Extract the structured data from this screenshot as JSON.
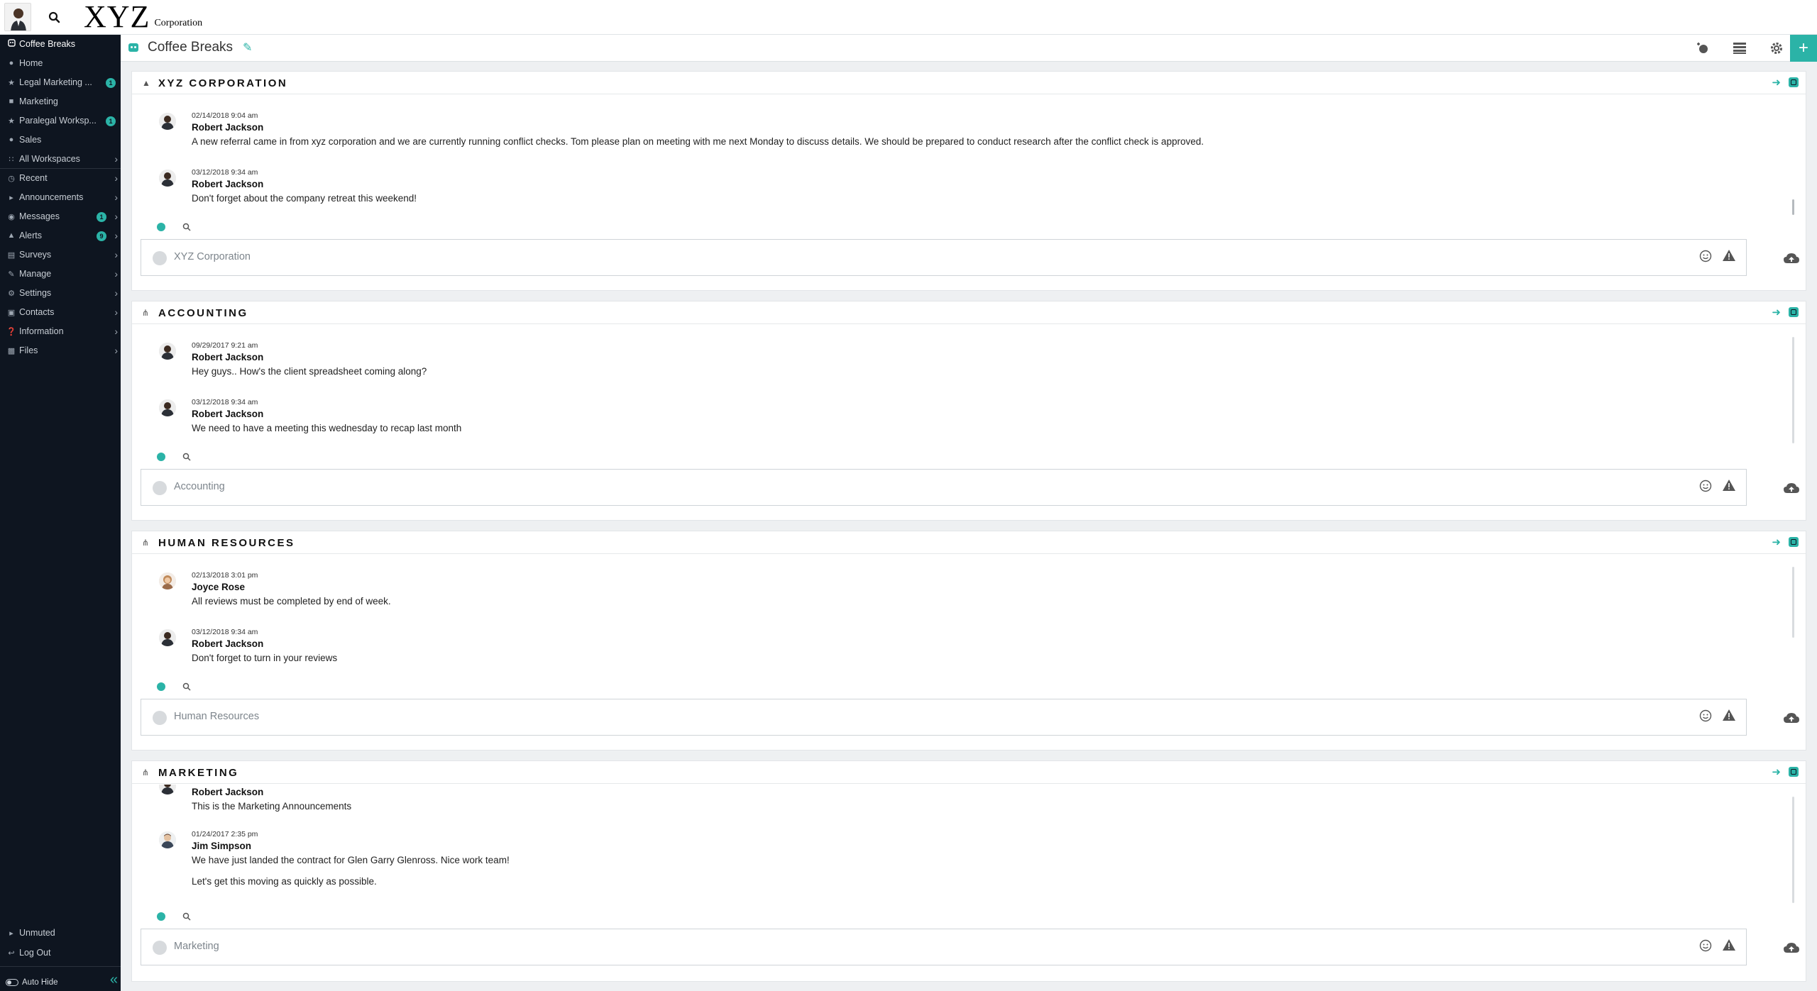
{
  "topbar": {
    "logo_big": "XYZ",
    "logo_small": "Corporation",
    "search_icon": "search-icon"
  },
  "sidebar": {
    "items": [
      {
        "label": "Coffee Breaks",
        "icon": "robot-icon",
        "active": true
      },
      {
        "label": "Home",
        "icon": "pin-icon"
      },
      {
        "label": "Legal Marketing ...",
        "icon": "star-icon",
        "badge": "1"
      },
      {
        "label": "Marketing",
        "icon": "building-icon"
      },
      {
        "label": "Paralegal Worksp...",
        "icon": "star-icon",
        "badge": "1"
      },
      {
        "label": "Sales",
        "icon": "pin-icon"
      },
      {
        "label": "All Workspaces",
        "icon": "grid-icon"
      },
      {
        "label": "Recent",
        "icon": "clock-icon"
      },
      {
        "label": "Announcements",
        "icon": "megaphone-icon"
      },
      {
        "label": "Messages",
        "icon": "chat-icon",
        "badge": "1"
      },
      {
        "label": "Alerts",
        "icon": "warning-icon",
        "badge": "9"
      },
      {
        "label": "Surveys",
        "icon": "survey-icon"
      },
      {
        "label": "Manage",
        "icon": "pencil-icon"
      },
      {
        "label": "Settings",
        "icon": "gear-icon"
      },
      {
        "label": "Contacts",
        "icon": "contacts-icon"
      },
      {
        "label": "Information",
        "icon": "question-icon"
      },
      {
        "label": "Files",
        "icon": "folder-icon"
      }
    ],
    "unmuted": "Unmuted",
    "logout": "Log Out",
    "autohide": "Auto Hide"
  },
  "header": {
    "title": "Coffee Breaks"
  },
  "panels": [
    {
      "title": "XYZ CORPORATION",
      "placeholder": "XYZ Corporation",
      "messages": [
        {
          "time": "02/14/2018 9:04 am",
          "name": "Robert Jackson",
          "text": "A new referral came in from xyz corporation and we are currently running conflict checks.  Tom please plan on meeting with me next Monday to discuss details.  We should be prepared to conduct research after the conflict check is approved.",
          "avatar": "man"
        },
        {
          "time": "03/12/2018 9:34 am",
          "name": "Robert Jackson",
          "text": "Don't forget about the company retreat this weekend!",
          "avatar": "man"
        }
      ]
    },
    {
      "title": "ACCOUNTING",
      "placeholder": "Accounting",
      "messages": [
        {
          "time": "09/29/2017 9:21 am",
          "name": "Robert Jackson",
          "text": "Hey guys.. How's the client spreadsheet coming along?",
          "avatar": "man"
        },
        {
          "time": "03/12/2018 9:34 am",
          "name": "Robert Jackson",
          "text": "We need to have a meeting this wednesday to recap last month",
          "avatar": "man"
        }
      ]
    },
    {
      "title": "HUMAN RESOURCES",
      "placeholder": "Human Resources",
      "messages": [
        {
          "time": "02/13/2018 3:01 pm",
          "name": "Joyce Rose",
          "text": "All reviews must be completed by end of week.",
          "avatar": "woman"
        },
        {
          "time": "03/12/2018 9:34 am",
          "name": "Robert Jackson",
          "text": "Don't forget to turn in your reviews",
          "avatar": "man"
        }
      ]
    },
    {
      "title": "MARKETING",
      "placeholder": "Marketing",
      "partial_name": "Robert Jackson",
      "partial_text": "This is the Marketing Announcements",
      "messages": [
        {
          "time": "01/24/2017 2:35 pm",
          "name": "Jim Simpson",
          "text": "We have just landed the contract for Glen Garry Glenross. Nice work team!",
          "text2": "Let's get this moving as quickly as possible.",
          "avatar": "man2"
        }
      ]
    }
  ],
  "colors": {
    "accent": "#2bb3a7",
    "sidebar_bg": "#0e1520",
    "page_bg": "#eef0f2"
  }
}
